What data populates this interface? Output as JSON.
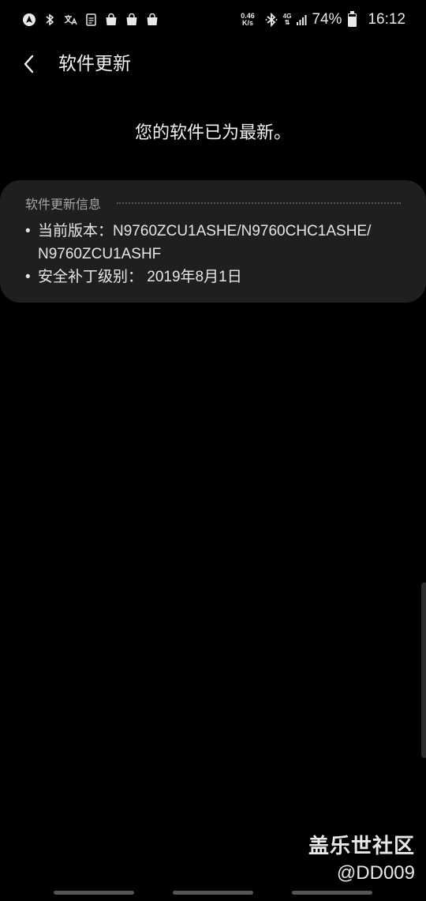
{
  "status_bar": {
    "left_icons": [
      "android-auto-icon",
      "bluetooth-small-icon",
      "translate-icon",
      "document-icon",
      "shopping-bag-icon",
      "shopping-bag-icon",
      "shopping-bag-icon"
    ],
    "net_speed_value": "0.46",
    "net_speed_unit": "K/s",
    "network_type": "4G",
    "battery_percent": "74%",
    "battery_level": 0.74,
    "time": "16:12"
  },
  "app_bar": {
    "title": "软件更新"
  },
  "main": {
    "message": "您的软件已为最新。"
  },
  "info_card": {
    "title": "软件更新信息",
    "items": [
      {
        "bullet": "•",
        "label": "当前版本：",
        "line1": "N9760ZCU1ASHE/N9760CHC1ASHE/",
        "line2": "N9760ZCU1ASHF"
      },
      {
        "bullet": "•",
        "label": "安全补丁级别：",
        "value": " 2019年8月1日"
      }
    ]
  },
  "watermark": {
    "title": "盖乐世社区",
    "user": "@DD009"
  },
  "colors": {
    "background": "#000000",
    "card": "#1f1f1f",
    "text_primary": "#f2f2f2",
    "text_secondary": "#a6a6a6"
  }
}
